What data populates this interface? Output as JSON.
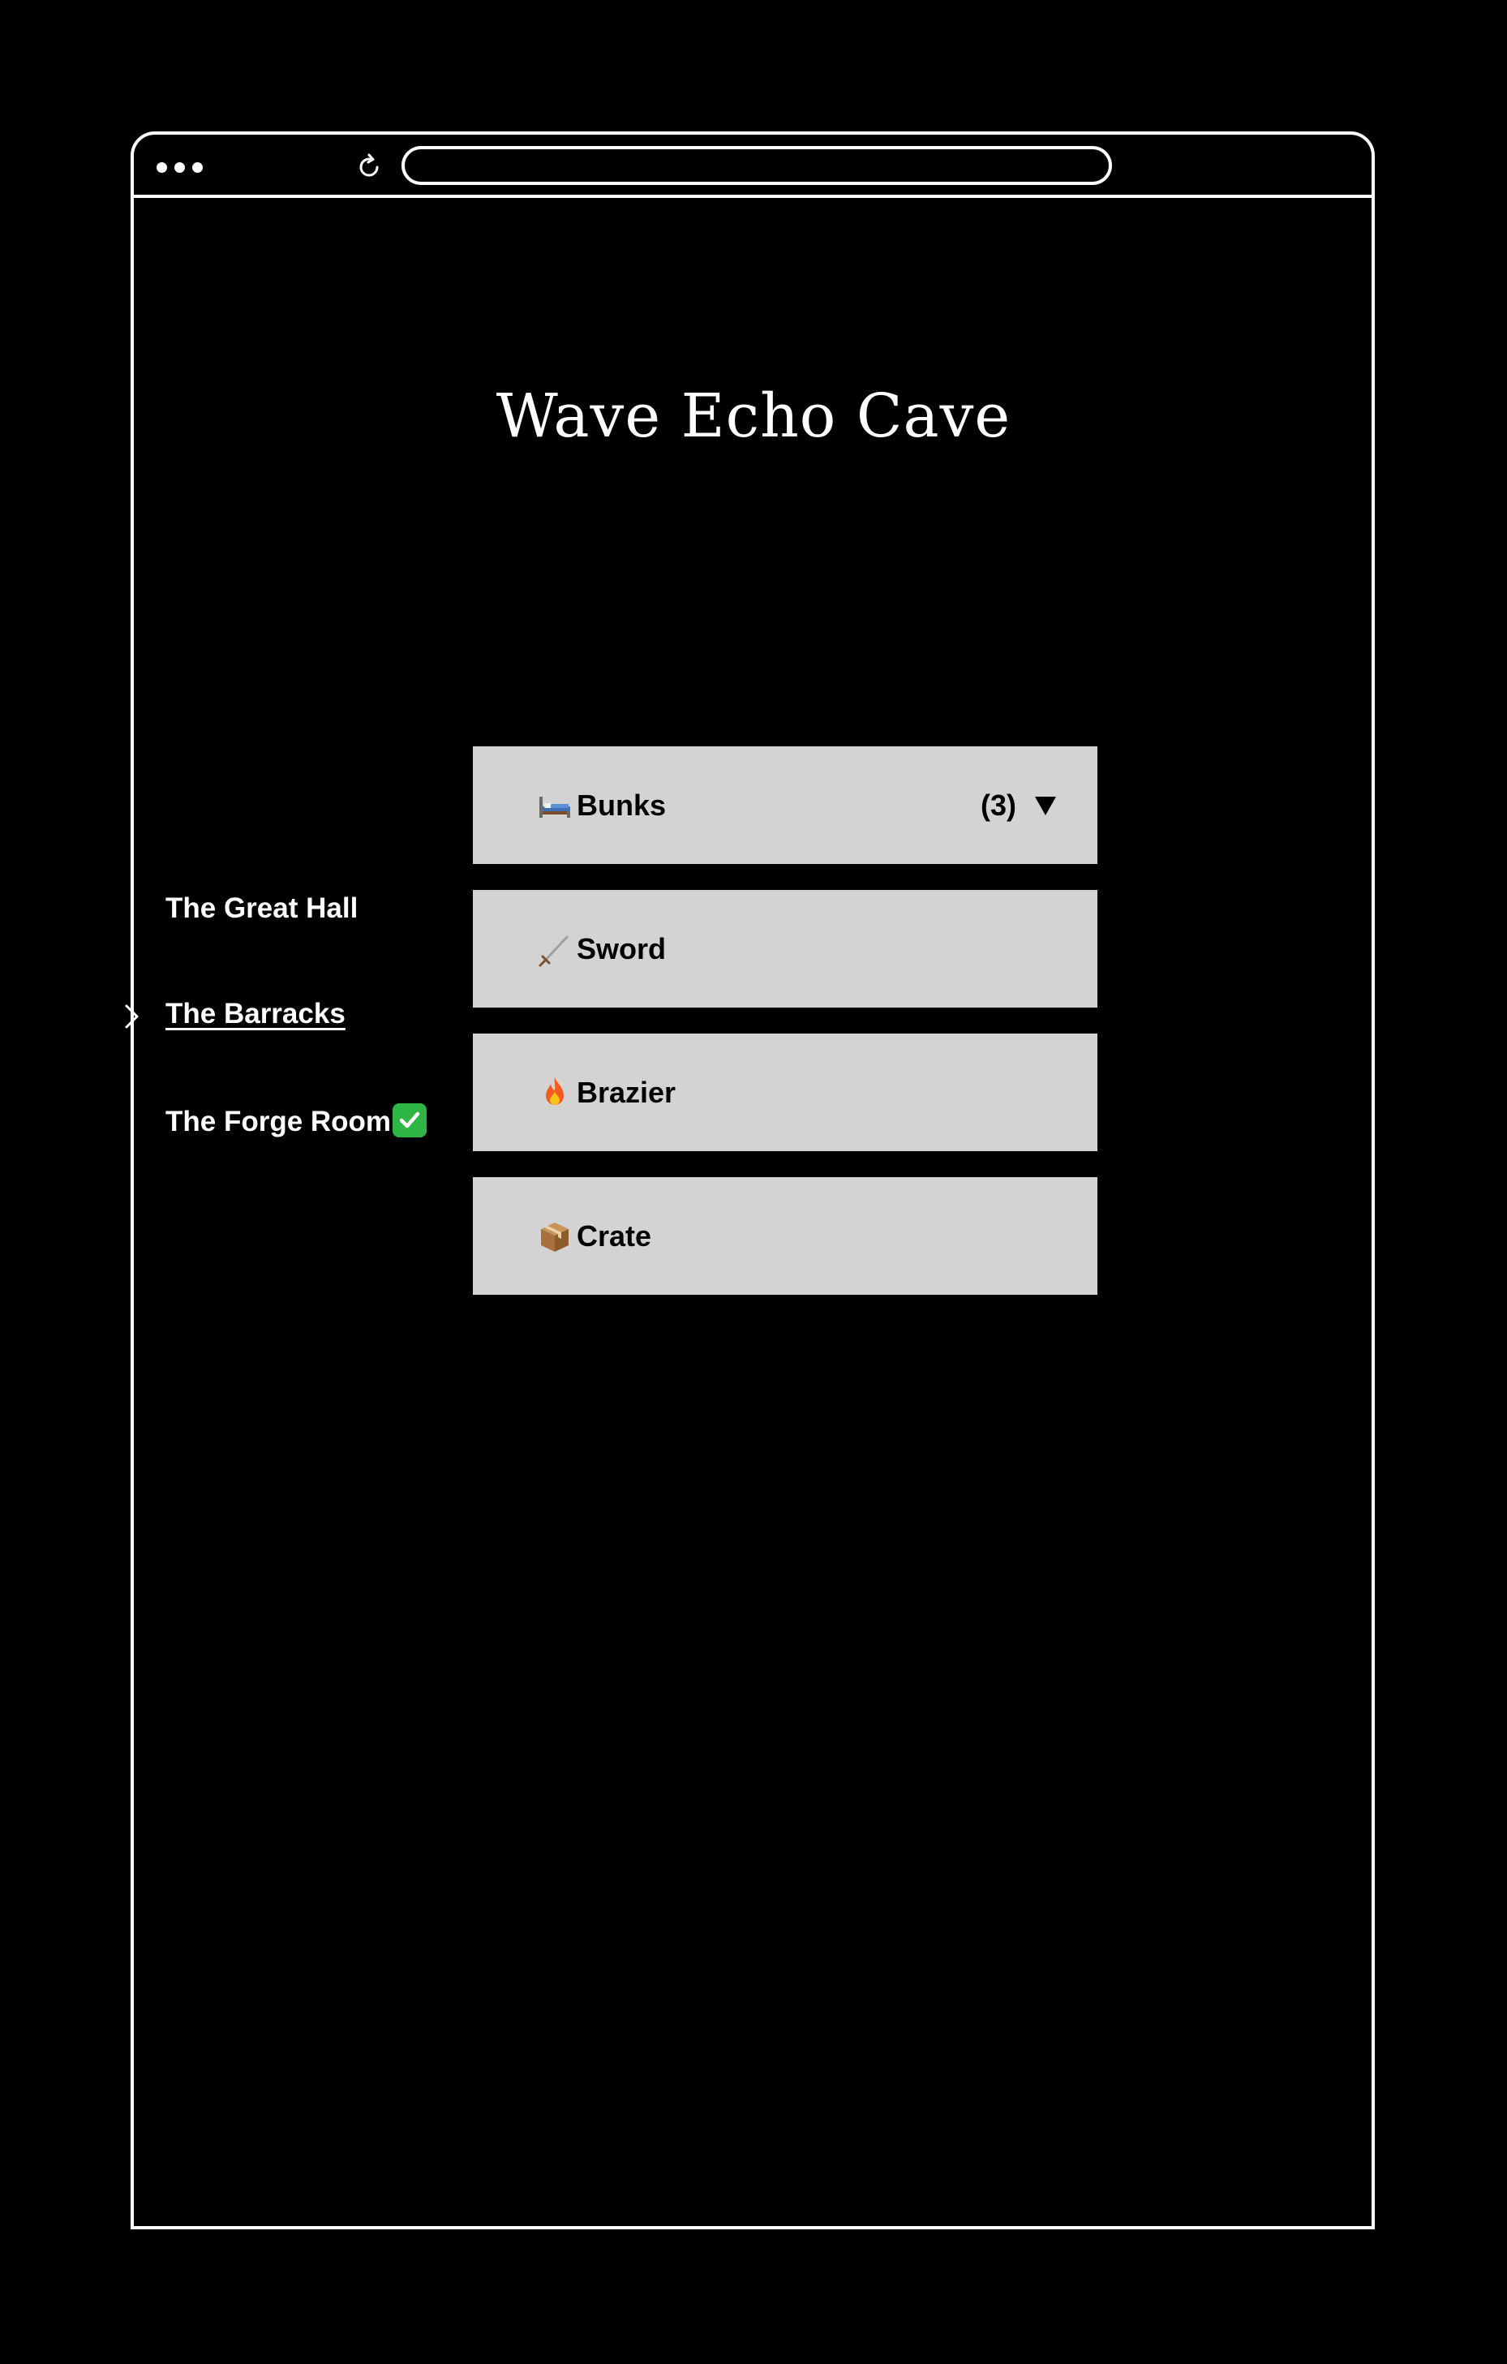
{
  "page": {
    "title": "Wave Echo Cave"
  },
  "rooms": [
    {
      "label": "The Great Hall",
      "active": false,
      "completed": false
    },
    {
      "label": "The Barracks",
      "active": true,
      "completed": false
    },
    {
      "label": "The Forge Room",
      "active": false,
      "completed": true
    }
  ],
  "items": [
    {
      "icon": "bed-icon",
      "label": "Bunks",
      "count": "(3)",
      "expandable": true
    },
    {
      "icon": "sword-icon",
      "label": "Sword"
    },
    {
      "icon": "fire-icon",
      "label": "Brazier"
    },
    {
      "icon": "package-icon",
      "label": "Crate"
    }
  ],
  "icons": {
    "check": "check-mark-button-icon",
    "chevron": "chevron-right-icon",
    "dropdown": "triangle-down-icon"
  },
  "colors": {
    "background": "#000000",
    "card": "#d3d3d3",
    "check": "#2fb544"
  }
}
